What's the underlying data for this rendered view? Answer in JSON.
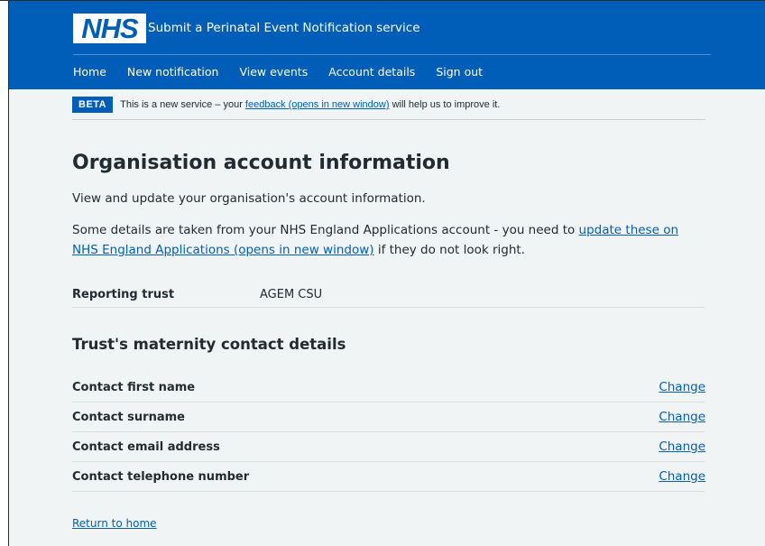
{
  "header": {
    "logo_text": "NHS",
    "service_name": "Submit a Perinatal Event Notification service",
    "nav": [
      "Home",
      "New notification",
      "View events",
      "Account details",
      "Sign out"
    ]
  },
  "beta": {
    "tag": "BETA",
    "text_before": "This is a new service – your ",
    "link": "feedback (opens in new window)",
    "text_after": " will help us to improve it."
  },
  "main": {
    "title": "Organisation account information",
    "lede": "View and update your organisation's account information.",
    "para_before": "Some details are taken from your NHS England Applications account - you need to ",
    "para_link": "update these on NHS England Applications (opens in new window)",
    "para_after": " if they do not look right."
  },
  "trust": {
    "key": "Reporting trust",
    "value": "AGEM CSU"
  },
  "contact": {
    "heading": "Trust's maternity contact details",
    "rows": [
      {
        "key": "Contact first name",
        "action": "Change"
      },
      {
        "key": "Contact surname",
        "action": "Change"
      },
      {
        "key": "Contact email address",
        "action": "Change"
      },
      {
        "key": "Contact telephone number",
        "action": "Change"
      }
    ]
  },
  "footer": {
    "return_link": "Return to home"
  },
  "colors": {
    "nhs_blue": "#005eb8",
    "background": "#f0f4f5",
    "text": "#212b32"
  }
}
